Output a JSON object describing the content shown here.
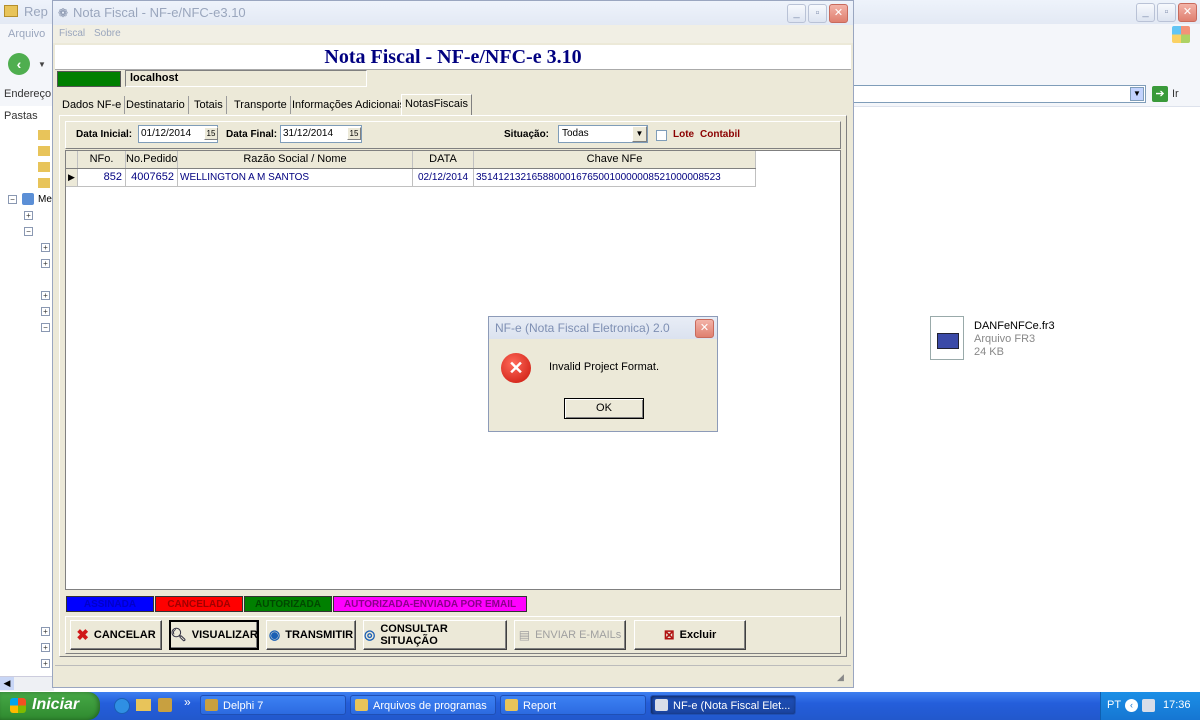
{
  "explorer": {
    "title": "Rep",
    "menu": {
      "arquivo": "Arquivo"
    },
    "address_label": "Endereço",
    "go_label": "Ir",
    "folders_label": "Pastas",
    "tree_item_label": "Me",
    "file": {
      "name": "DANFeNFCe.fr3",
      "type": "Arquivo FR3",
      "size": "24 KB"
    }
  },
  "app": {
    "title": "Nota Fiscal - NF-e/NFC-e3.10",
    "menu": [
      "Fiscal",
      "Sobre"
    ],
    "header_title": "Nota Fiscal - NF-e/NFC-e 3.10",
    "server": "localhost",
    "tabs": [
      "Dados NF-e",
      "Destinatario",
      "Totais",
      "Transporte",
      "Informações Adicionais",
      "NotasFiscais"
    ],
    "active_tab": "NotasFiscais",
    "filters": {
      "data_inicial_label": "Data Inicial:",
      "data_inicial": "01/12/2014",
      "data_final_label": "Data Final:",
      "data_final": "31/12/2014",
      "calendar_glyph": "15",
      "situacao_label": "Situação:",
      "situacao": "Todas",
      "lote_label": "Lote",
      "contabil_label": "Contabil"
    },
    "grid": {
      "columns": [
        "NFo.",
        "No.Pedido",
        "Razão Social / Nome",
        "DATA",
        "Chave NFe"
      ],
      "rows": [
        [
          "852",
          "4007652",
          "WELLINGTON A M SANTOS",
          "02/12/2014",
          "35141213216588000167650010000008521000008523"
        ]
      ]
    },
    "legend": [
      {
        "label": "ASSINADA",
        "bg": "#0000ff",
        "fg": "#0000c8"
      },
      {
        "label": "CANCELADA",
        "bg": "#ff0000",
        "fg": "#a00000"
      },
      {
        "label": "AUTORIZADA",
        "bg": "#008000",
        "fg": "#004800"
      },
      {
        "label": "AUTORIZADA-ENVIADA POR EMAIL",
        "bg": "#ff00ff",
        "fg": "#8a008a"
      }
    ],
    "buttons": {
      "cancelar": "CANCELAR",
      "visualizar": "VISUALIZAR",
      "transmitir": "TRANSMITIR",
      "consultar": "CONSULTAR SITUAÇÃO",
      "enviar": "ENVIAR E-MAILs",
      "excluir": "Excluir"
    }
  },
  "dialog": {
    "title": "NF-e (Nota Fiscal Eletronica) 2.0",
    "message": "Invalid Project Format.",
    "ok_label": "OK"
  },
  "taskbar": {
    "start_label": "Iniciar",
    "more": "»",
    "items": [
      "Delphi 7",
      "Arquivos de programas",
      "Report",
      "NF-e (Nota Fiscal Elet..."
    ],
    "lang": "PT",
    "clock": "17:36"
  },
  "colors": {
    "accent": "#000080",
    "dialog_title": "#7e8fb3",
    "taskbar": "#245edb",
    "start": "#3c9a3c"
  }
}
